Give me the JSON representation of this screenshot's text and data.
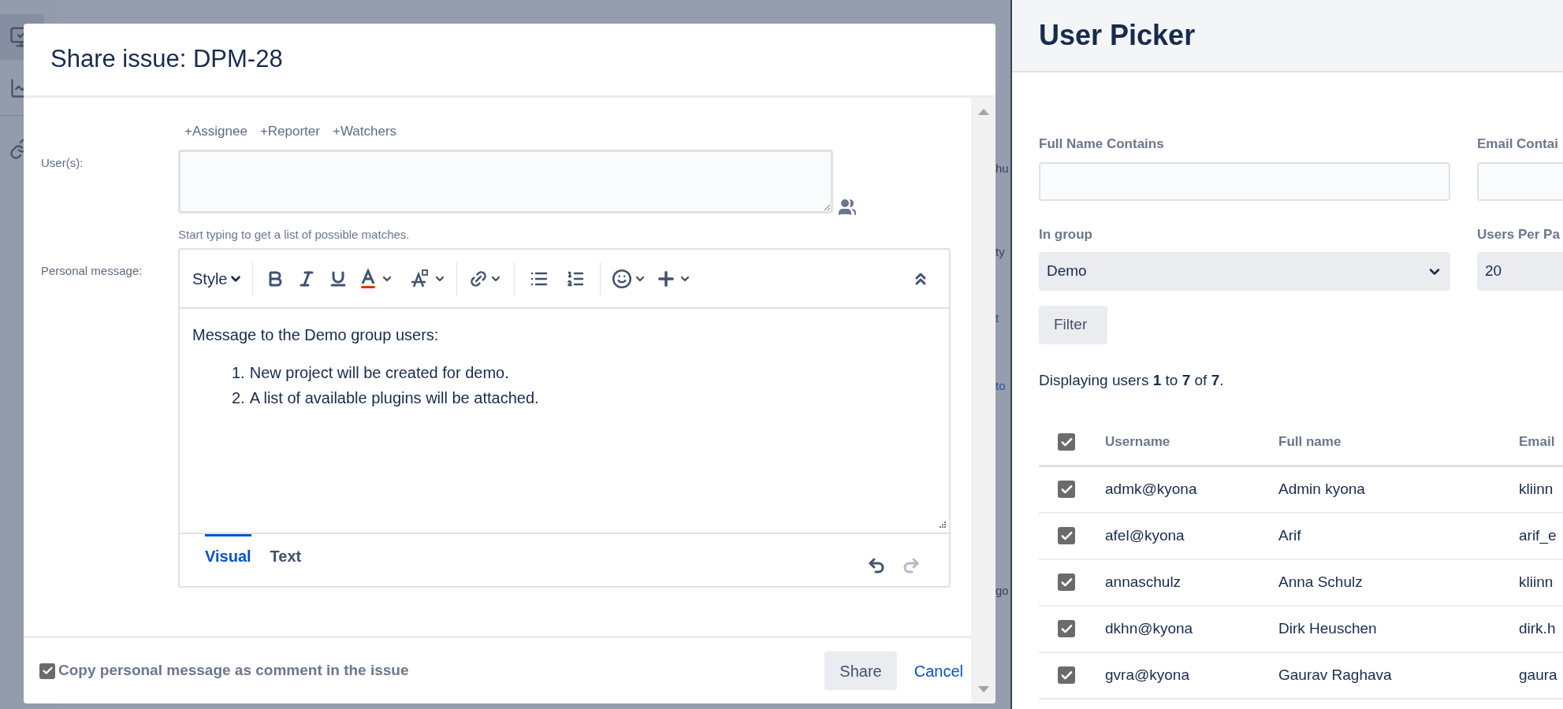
{
  "background": {
    "text_fragments": [
      {
        "text": "hu",
        "kind": "plain"
      },
      {
        "text": "ty",
        "kind": "plain"
      },
      {
        "text": "t",
        "kind": "link"
      },
      {
        "text": "to",
        "kind": "link"
      },
      {
        "text": "go",
        "kind": "plain"
      }
    ]
  },
  "dialog": {
    "title": "Share issue: DPM-28",
    "user_links": [
      "+Assignee",
      "+Reporter",
      "+Watchers"
    ],
    "users_label": "User(s):",
    "users_hint": "Start typing to get a list of possible matches.",
    "message_label": "Personal message:",
    "style_label": "Style",
    "message": {
      "intro": "Message to the Demo group users:",
      "items": [
        {
          "number": "1.",
          "text": "New project will be created for demo."
        },
        {
          "number": "2.",
          "text": "A list of available plugins will be attached."
        }
      ]
    },
    "editor_tabs": [
      {
        "label": "Visual",
        "selected": true
      },
      {
        "label": "Text",
        "selected": false
      }
    ],
    "copy_comment": {
      "label": "Copy personal message as comment in the issue",
      "checked": true
    },
    "buttons": [
      {
        "label": "Share",
        "kind": "primary"
      },
      {
        "label": "Cancel",
        "kind": "link"
      }
    ]
  },
  "user_picker": {
    "title": "User Picker",
    "filters": [
      {
        "label": "Full Name Contains",
        "kind": "text"
      },
      {
        "label": "Email Contai",
        "kind": "text"
      },
      {
        "label": "In group",
        "kind": "select",
        "value": "Demo",
        "arrow_visible": true
      },
      {
        "label": "Users Per Pa",
        "kind": "select",
        "value": "20"
      }
    ],
    "filter_button": "Filter",
    "summary": "Displaying users **1** to **7** of **7**.",
    "table": {
      "all_checked": true,
      "columns": [
        "Username",
        "Full name",
        "Email"
      ],
      "rows": [
        {
          "username": "admk@kyona",
          "full_name": "Admin kyona",
          "email": "kliinn",
          "checked": true
        },
        {
          "username": "afel@kyona",
          "full_name": "Arif",
          "email": "arif_e",
          "checked": true
        },
        {
          "username": "annaschulz",
          "full_name": "Anna Schulz",
          "email": "kliinn",
          "checked": true
        },
        {
          "username": "dkhn@kyona",
          "full_name": "Dirk Heuschen",
          "email": "dirk.h",
          "checked": true
        },
        {
          "username": "gvra@kyona",
          "full_name": "Gaurav Raghava",
          "email": "gaura",
          "checked": true
        }
      ]
    }
  }
}
